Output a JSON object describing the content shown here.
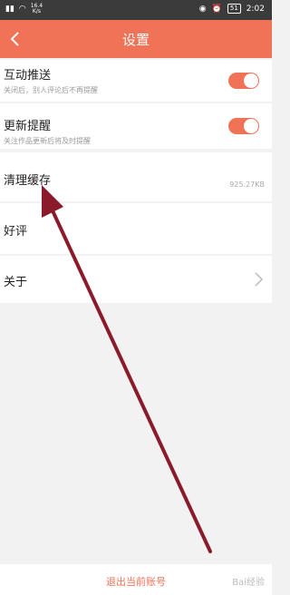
{
  "status_bar": {
    "net_speed_value": "16.4",
    "net_speed_unit": "K/s",
    "battery": "51",
    "time": "2:02"
  },
  "header": {
    "title": "设置",
    "back_icon": "chevron-left-icon"
  },
  "settings": [
    {
      "title": "互动推送",
      "subtitle": "关闭后，别人评论后不再提醒",
      "toggle_on": true
    },
    {
      "title": "更新提醒",
      "subtitle": "关注作品更新后将及时提醒",
      "toggle_on": true
    },
    {
      "title": "清理缓存",
      "value": "925.27KB"
    },
    {
      "title": "好评"
    },
    {
      "title": "关于"
    }
  ],
  "logout": {
    "label": "退出当前账号"
  },
  "watermark": {
    "text": "Bai经验"
  },
  "colors": {
    "accent": "#f07358",
    "status_bar": "#3b3b3b",
    "arrow": "#8b1a2a"
  }
}
